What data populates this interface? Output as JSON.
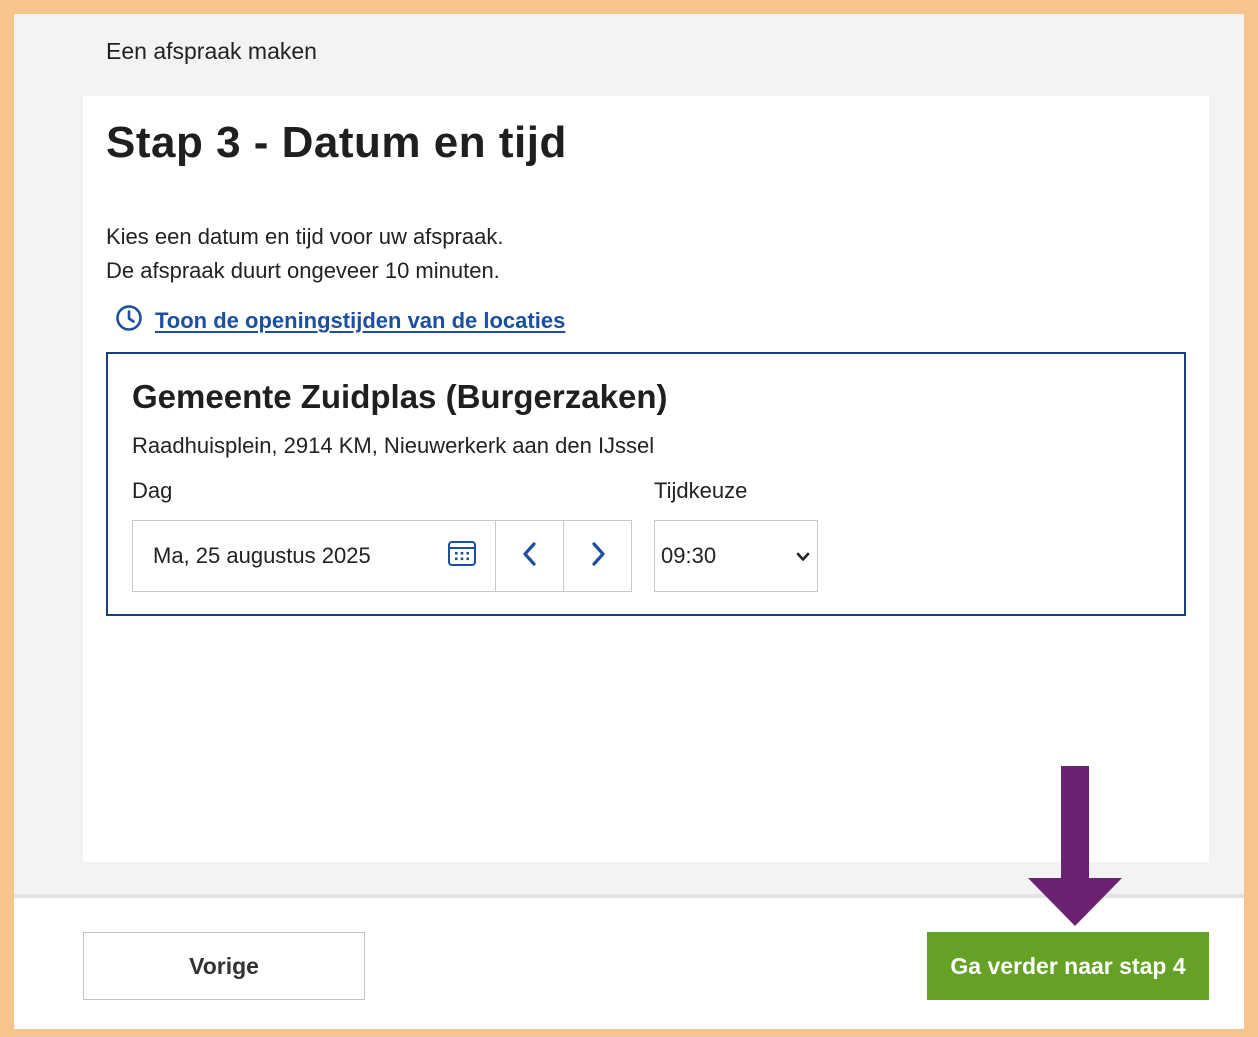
{
  "breadcrumb": "Een afspraak maken",
  "title": "Stap 3 - Datum en tijd",
  "intro": {
    "line1": "Kies een datum en tijd voor uw afspraak.",
    "line2": "De afspraak duurt ongeveer 10 minuten."
  },
  "hours_link": {
    "icon": "clock-icon",
    "label": "Toon de openingstijden van de locaties"
  },
  "location": {
    "name": "Gemeente Zuidplas (Burgerzaken)",
    "address": "Raadhuisplein, 2914 KM, Nieuwerkerk aan den IJssel",
    "day_label": "Dag",
    "date_value": "Ma, 25 augustus 2025",
    "time_label": "Tijdkeuze",
    "time_value": "09:30"
  },
  "footer": {
    "prev_label": "Vorige",
    "next_label": "Ga verder naar stap 4"
  },
  "colors": {
    "accent_blue": "#1d4fa0",
    "box_border": "#1c3f7f",
    "next_green": "#64a125",
    "annotation_arrow": "#6a2273",
    "frame_orange": "#f6c48d"
  }
}
